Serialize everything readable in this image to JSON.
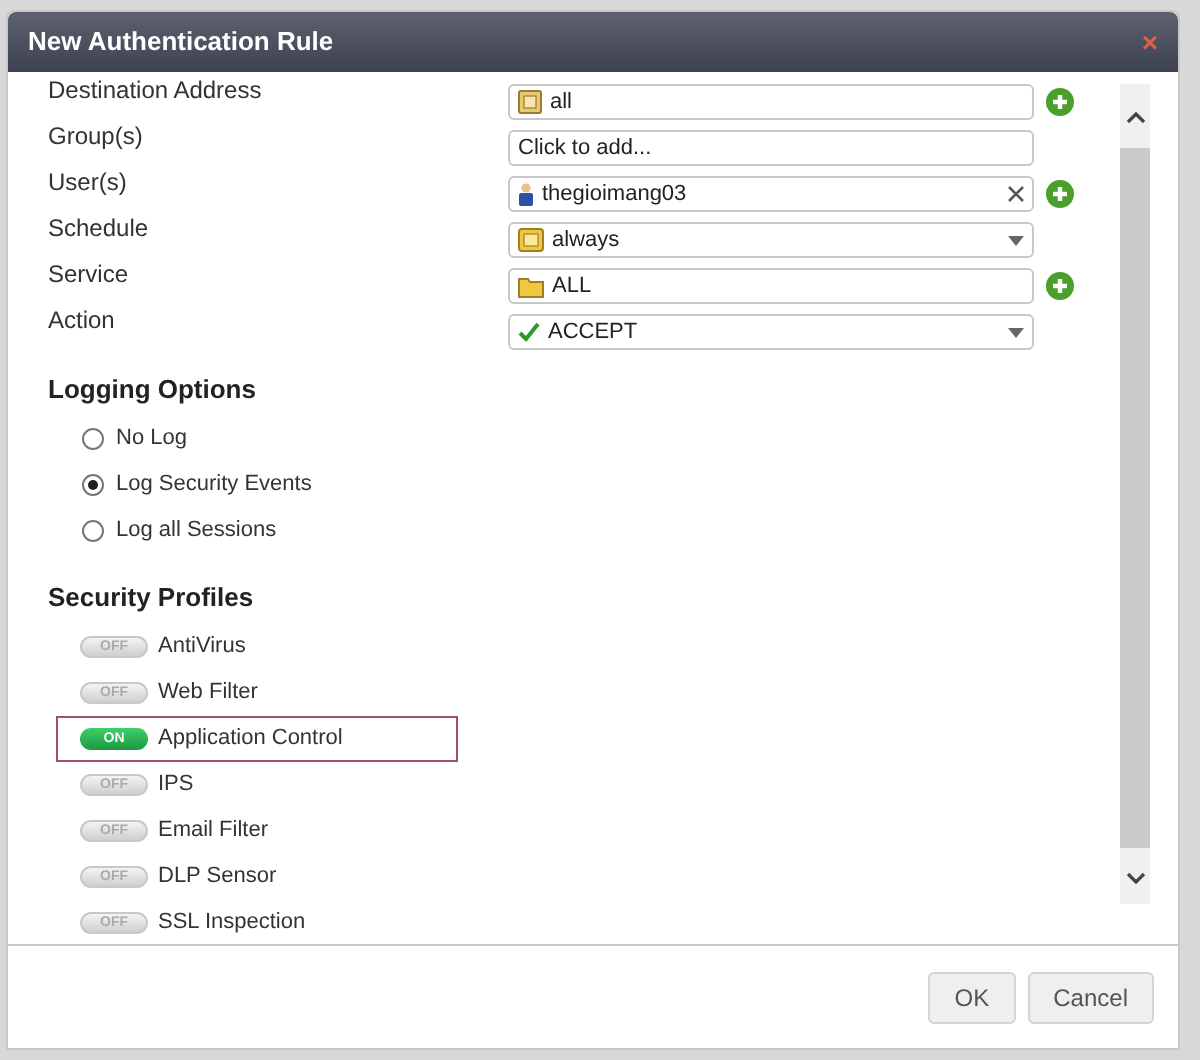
{
  "dialog": {
    "title": "New Authentication Rule",
    "close": "×"
  },
  "fields": [
    {
      "label": "Destination Address",
      "value": "all",
      "kind": "address",
      "dropdown": false,
      "clearable": false,
      "add_button": true
    },
    {
      "label": "Group(s)",
      "placeholder": "Click to add...",
      "kind": "plain",
      "dropdown": false,
      "clearable": false,
      "add_button": false
    },
    {
      "label": "User(s)",
      "value": "thegioimang03",
      "kind": "user",
      "dropdown": false,
      "clearable": true,
      "add_button": true
    },
    {
      "label": "Schedule",
      "value": "always",
      "kind": "schedule",
      "dropdown": true,
      "clearable": false,
      "add_button": false
    },
    {
      "label": "Service",
      "value": "ALL",
      "kind": "service",
      "dropdown": false,
      "clearable": false,
      "add_button": true
    },
    {
      "label": "Action",
      "value": "ACCEPT",
      "kind": "action",
      "dropdown": true,
      "clearable": false,
      "add_button": false
    }
  ],
  "logging": {
    "title": "Logging Options",
    "options": [
      {
        "label": "No Log",
        "selected": false
      },
      {
        "label": "Log Security Events",
        "selected": true
      },
      {
        "label": "Log all Sessions",
        "selected": false
      }
    ]
  },
  "profiles": {
    "title": "Security Profiles",
    "items": [
      {
        "label": "AntiVirus",
        "on": false,
        "switch_text": "OFF",
        "highlighted": false
      },
      {
        "label": "Web Filter",
        "on": false,
        "switch_text": "OFF",
        "highlighted": false
      },
      {
        "label": "Application Control",
        "on": true,
        "switch_text": "ON",
        "highlighted": true
      },
      {
        "label": "IPS",
        "on": false,
        "switch_text": "OFF",
        "highlighted": false
      },
      {
        "label": "Email Filter",
        "on": false,
        "switch_text": "OFF",
        "highlighted": false
      },
      {
        "label": "DLP Sensor",
        "on": false,
        "switch_text": "OFF",
        "highlighted": false
      },
      {
        "label": "SSL Inspection",
        "on": false,
        "switch_text": "OFF",
        "highlighted": false
      }
    ]
  },
  "buttons": [
    "OK",
    "Cancel"
  ]
}
